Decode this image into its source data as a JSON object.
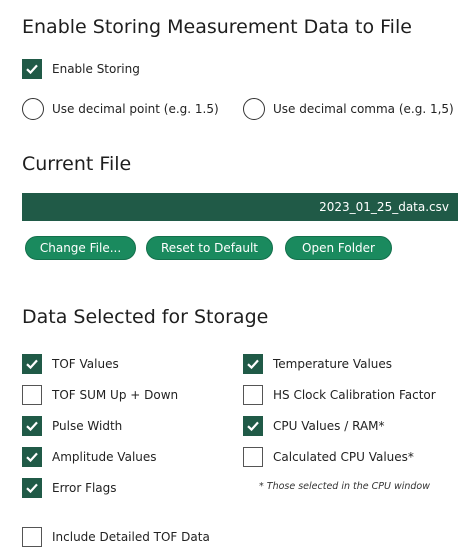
{
  "enable_section": {
    "title": "Enable Storing Measurement Data to File",
    "enable_storing": {
      "label": "Enable Storing",
      "checked": true
    },
    "decimal_point": {
      "label": "Use decimal point (e.g. 1.5)",
      "selected": false
    },
    "decimal_comma": {
      "label": "Use decimal comma (e.g. 1,5)",
      "selected": false
    }
  },
  "file_section": {
    "title": "Current File",
    "filename": "2023_01_25_data.csv",
    "buttons": {
      "change": "Change File...",
      "reset": "Reset to Default",
      "open": "Open Folder"
    }
  },
  "data_section": {
    "title": "Data Selected for Storage",
    "left": [
      {
        "label": "TOF Values",
        "checked": true
      },
      {
        "label": "TOF SUM Up + Down",
        "checked": false
      },
      {
        "label": "Pulse Width",
        "checked": true
      },
      {
        "label": "Amplitude Values",
        "checked": true
      },
      {
        "label": "Error Flags",
        "checked": true
      }
    ],
    "right": [
      {
        "label": "Temperature Values",
        "checked": true
      },
      {
        "label": "HS Clock Calibration Factor",
        "checked": false
      },
      {
        "label": "CPU Values / RAM*",
        "checked": true
      },
      {
        "label": "Calculated CPU Values*",
        "checked": false
      }
    ],
    "cpu_note": "* Those selected in the CPU window",
    "include_detailed": {
      "label": "Include Detailed TOF Data",
      "checked": false
    }
  },
  "colors": {
    "accent_dark": "#205a47",
    "button": "#1a8a5e"
  }
}
